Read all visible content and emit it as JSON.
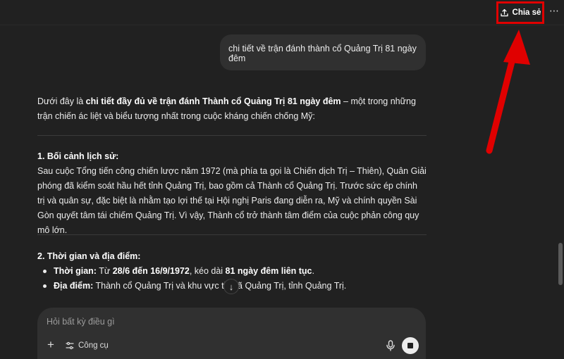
{
  "topbar": {
    "share_label": "Chia sẻ",
    "share_icon": "share-upload-icon",
    "more_icon": "ellipsis-icon",
    "annotation_color": "#e00000"
  },
  "user_message": "chi tiết về trận đánh thành cổ Quảng Trị 81 ngày đêm",
  "intro": {
    "before": "Dưới đây là ",
    "bold": "chi tiết đầy đủ về trận đánh Thành cổ Quảng Trị 81 ngày đêm",
    "after": " – một trong những trận chiến ác liệt và biểu tượng nhất trong cuộc kháng chiến chống Mỹ:"
  },
  "section1": {
    "title": "1. Bối cảnh lịch sử:",
    "text": "Sau cuộc Tổng tiến công chiến lược năm 1972 (mà phía ta gọi là Chiến dịch Trị – Thiên), Quân Giải phóng đã kiểm soát hầu hết tỉnh Quảng Trị, bao gồm cả Thành cổ Quảng Trị. Trước sức ép chính trị và quân sự, đặc biệt là nhằm tạo lợi thế tại Hội nghị Paris đang diễn ra, Mỹ và chính quyền Sài Gòn quyết tâm tái chiếm Quảng Trị. Vì vậy, Thành cổ trở thành tâm điểm của cuộc phản công quy mô lớn."
  },
  "section2": {
    "title": "2. Thời gian và địa điểm:",
    "bullet1": {
      "label": "Thời gian:",
      "t1": " Từ ",
      "b1": "28/6 đến 16/9/1972",
      "t2": ", kéo dài ",
      "b2": "81 ngày đêm liên tục",
      "t3": "."
    },
    "bullet2": {
      "label": "Địa điểm:",
      "text": " Thành cổ Quảng Trị và khu vực thị xã Quảng Trị, tỉnh Quảng Trị."
    }
  },
  "composer": {
    "placeholder": "Hỏi bất kỳ điều gì",
    "tools_label": "Công cụ"
  }
}
